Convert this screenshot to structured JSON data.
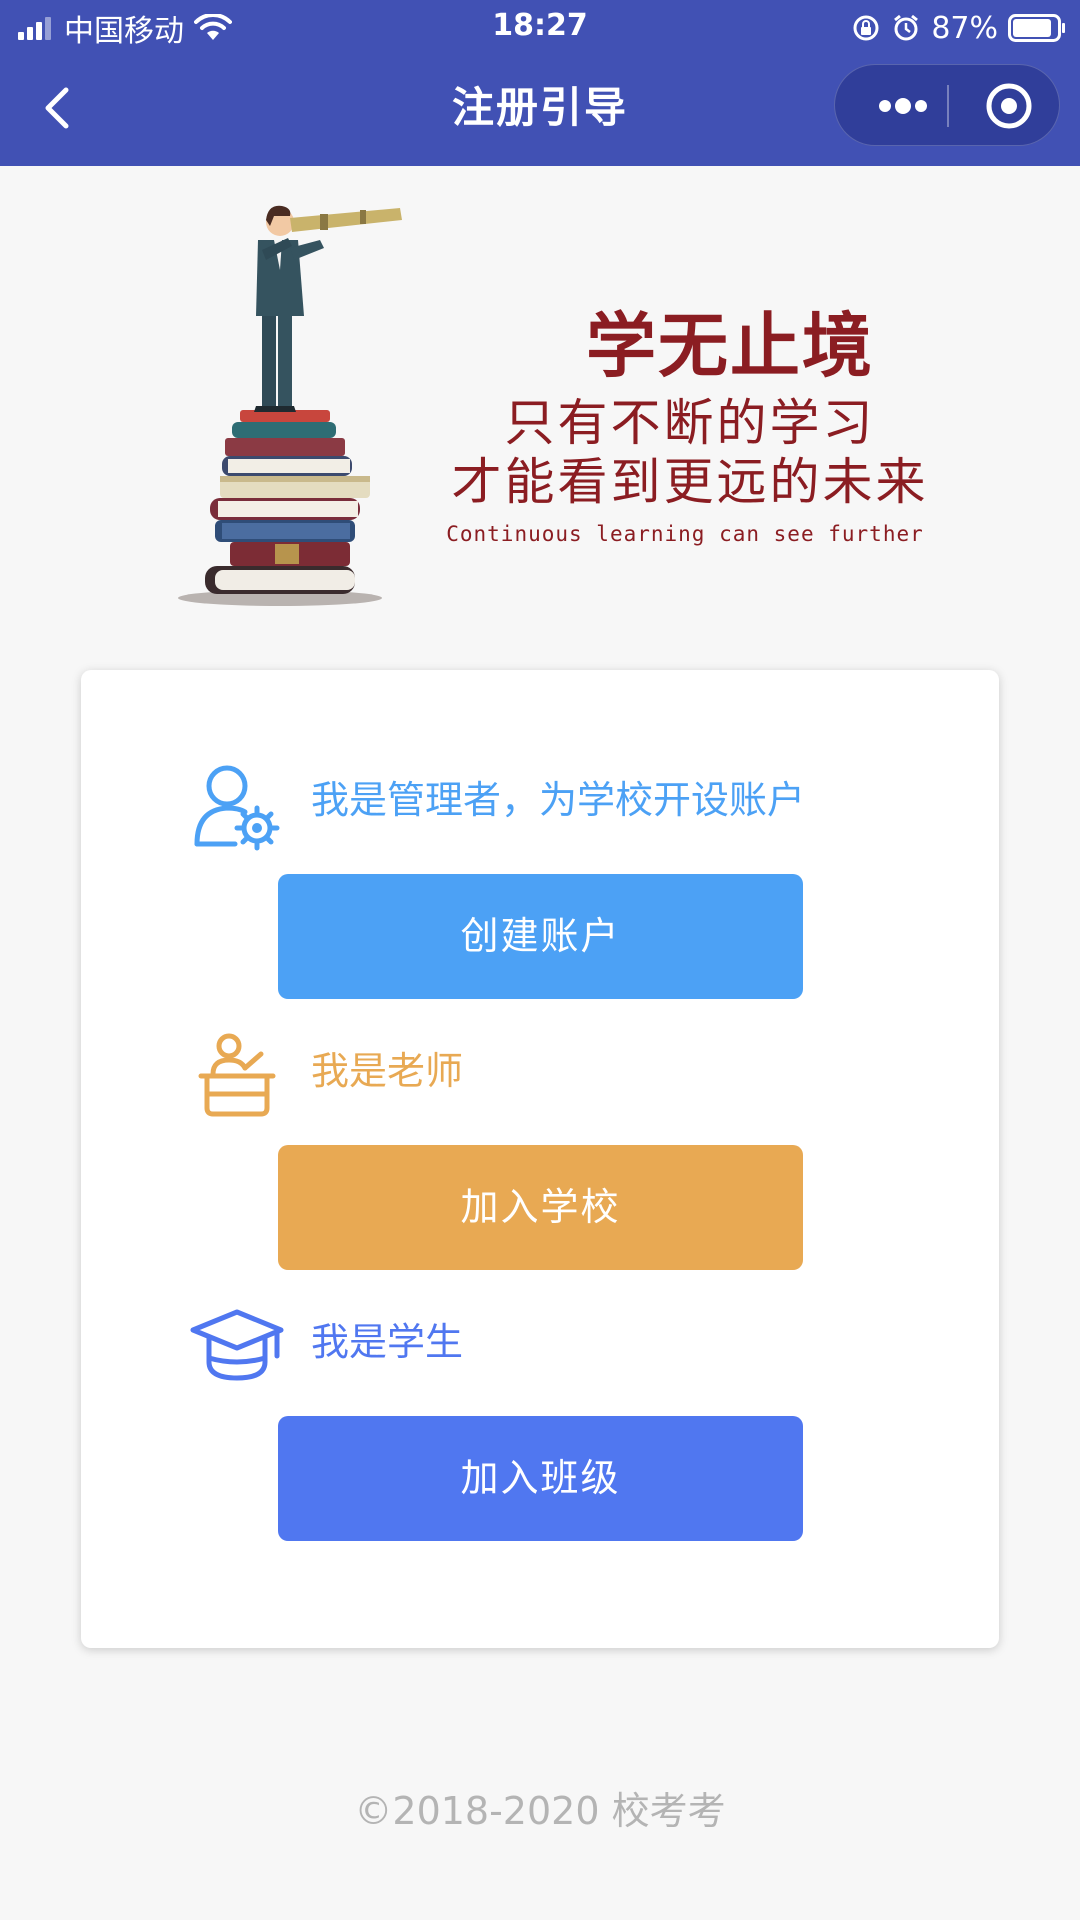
{
  "status_bar": {
    "carrier": "中国移动",
    "time": "18:27",
    "battery": "87%",
    "battery_level": 0.87
  },
  "nav": {
    "title": "注册引导"
  },
  "hero": {
    "title": "学无止境",
    "line1": "只有不断的学习",
    "line2": "才能看到更远的未来",
    "english": "Continuous learning can see further"
  },
  "roles": {
    "admin": {
      "text": "我是管理者，为学校开设账户",
      "button": "创建账户",
      "color": "#4ca1f5",
      "icon": "admin-gear-icon"
    },
    "teacher": {
      "text": "我是老师",
      "button": "加入学校",
      "color": "#e8a953",
      "icon": "teacher-icon"
    },
    "student": {
      "text": "我是学生",
      "button": "加入班级",
      "color": "#5077f0",
      "icon": "graduation-cap-icon"
    }
  },
  "footer": {
    "copyright": "©2018-2020 校考考"
  }
}
